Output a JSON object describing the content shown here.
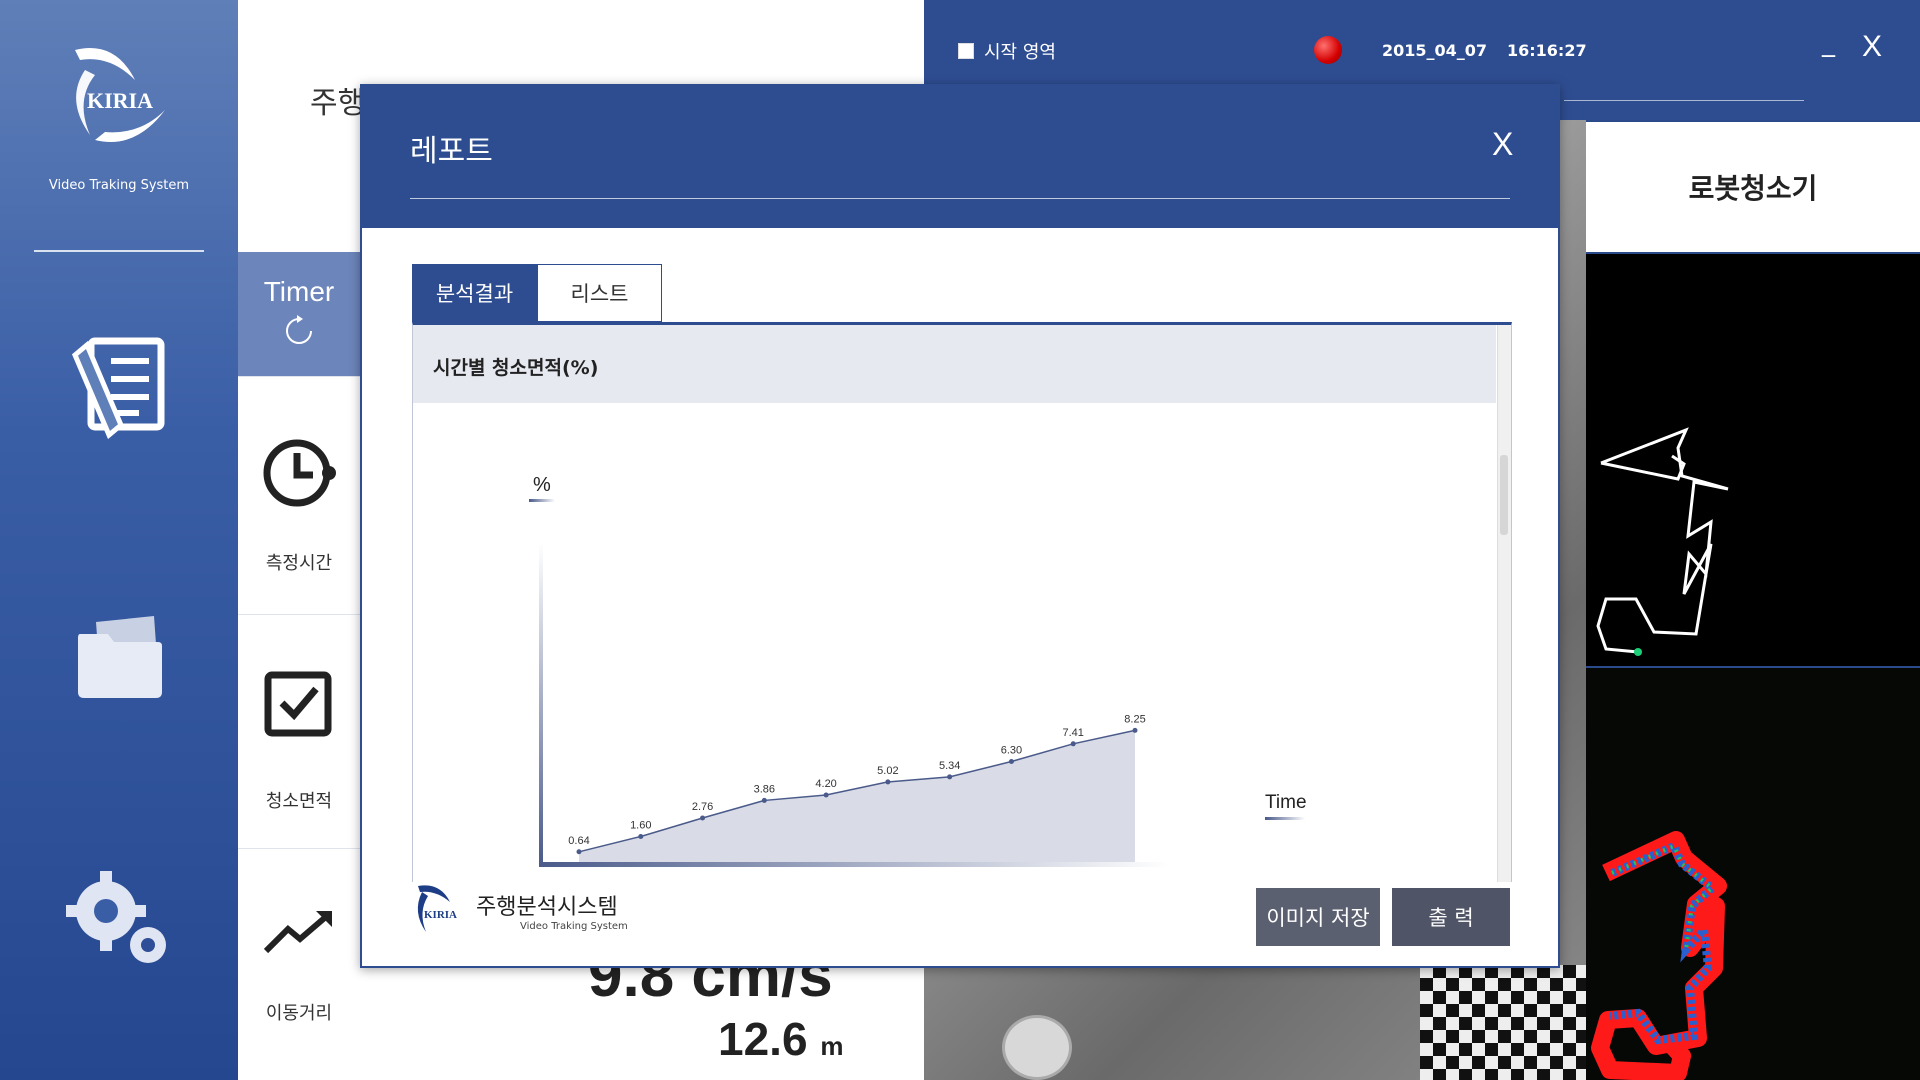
{
  "app": {
    "logo_text": "KIRIA",
    "subtitle": "Video Traking System"
  },
  "sidebar": {
    "items": [
      {
        "icon": "report-document-icon"
      },
      {
        "icon": "folder-icon"
      },
      {
        "icon": "settings-gears-icon"
      }
    ]
  },
  "main": {
    "page_title": "주행",
    "timer_label": "Timer",
    "metrics": [
      {
        "label": "측정시간",
        "icon": "clock-icon"
      },
      {
        "label": "청소면적",
        "icon": "checkbox-icon"
      },
      {
        "label": "이동거리",
        "icon": "trend-up-icon"
      }
    ],
    "speed_value": "9.8 cm/s",
    "distance_value": "12.6",
    "distance_unit": "m"
  },
  "topbar": {
    "start_area_label": "시작 영역",
    "date": "2015_04_07",
    "time": "16:16:27",
    "minimize": "_",
    "close": "X"
  },
  "right_panel": {
    "title": "로봇청소기"
  },
  "modal": {
    "title": "레포트",
    "close": "X",
    "tabs": [
      {
        "label": "분석결과",
        "active": true
      },
      {
        "label": "리스트",
        "active": false
      }
    ],
    "section_title": "시간별 청소면적(%)",
    "footer_logo_text": "KIRIA",
    "footer_title": "주행분석시스템",
    "footer_subtitle": "Video Traking System",
    "save_button": "이미지 저장",
    "print_button": "출 력"
  },
  "chart_data": {
    "type": "area",
    "ylabel": "%",
    "xlabel": "Time",
    "values": [
      0.64,
      1.6,
      2.76,
      3.86,
      4.2,
      5.02,
      5.34,
      6.3,
      7.41,
      8.25
    ],
    "value_labels": [
      "0.64",
      "1.60",
      "2.76",
      "3.86",
      "4.20",
      "5.02",
      "5.34",
      "6.30",
      "7.41",
      "8.25"
    ],
    "ylim": [
      0,
      20
    ],
    "grid": false,
    "colors": {
      "line": "#4a5a8a",
      "fill": "#d9dce6"
    }
  },
  "colors": {
    "primary": "#2e4d91",
    "sidebar_top": "#5f7fb8",
    "button": "#5b6070",
    "record": "#d40000"
  }
}
